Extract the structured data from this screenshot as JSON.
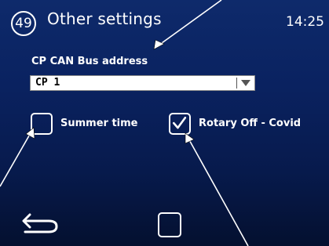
{
  "header": {
    "page_number": "49",
    "title": "Other settings",
    "time": "14:25"
  },
  "canbus": {
    "label": "CP CAN Bus address",
    "selected_value": "CP 1"
  },
  "options": {
    "summer_time": {
      "label": "Summer time",
      "checked": false
    },
    "rotary_off": {
      "label": "Rotary Off - Covid",
      "checked": true
    }
  },
  "footer": {
    "back_icon": "back-arrow-icon",
    "home_icon": "home-square-icon"
  },
  "colors": {
    "background_top": "#0e2a6b",
    "background_bottom": "#04102f",
    "text": "#ffffff"
  }
}
